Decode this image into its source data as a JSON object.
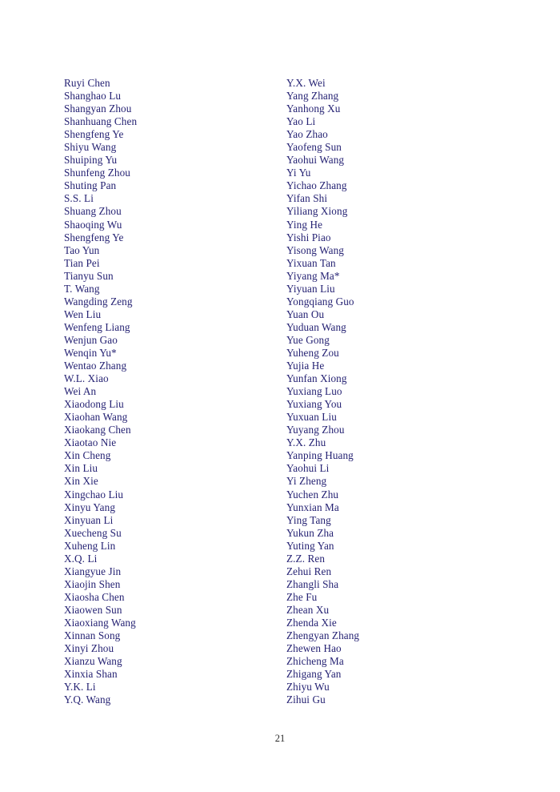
{
  "document": {
    "page_number": "21",
    "text_color": "#252273",
    "page_number_color": "#2a2a2a",
    "background_color": "#ffffff"
  },
  "columns": {
    "left": [
      "Ruyi Chen",
      "Shanghao Lu",
      "Shangyan Zhou",
      "Shanhuang Chen",
      "Shengfeng Ye",
      "Shiyu Wang",
      "Shuiping Yu",
      "Shunfeng Zhou",
      "Shuting Pan",
      "S.S. Li",
      "Shuang Zhou",
      "Shaoqing Wu",
      "Shengfeng Ye",
      "Tao Yun",
      "Tian Pei",
      "Tianyu Sun",
      "T. Wang",
      "Wangding Zeng",
      "Wen Liu",
      "Wenfeng Liang",
      "Wenjun Gao",
      "Wenqin Yu*",
      "Wentao Zhang",
      "W.L. Xiao",
      "Wei An",
      "Xiaodong Liu",
      "Xiaohan Wang",
      "Xiaokang Chen",
      "Xiaotao Nie",
      "Xin Cheng",
      "Xin Liu",
      "Xin Xie",
      "Xingchao Liu",
      "Xinyu Yang",
      "Xinyuan Li",
      "Xuecheng Su",
      "Xuheng Lin",
      "X.Q. Li",
      "Xiangyue Jin",
      "Xiaojin Shen",
      "Xiaosha Chen",
      "Xiaowen Sun",
      "Xiaoxiang Wang",
      "Xinnan Song",
      "Xinyi Zhou",
      "Xianzu Wang",
      "Xinxia Shan",
      "Y.K. Li",
      "Y.Q. Wang"
    ],
    "right": [
      "Y.X. Wei",
      "Yang Zhang",
      "Yanhong Xu",
      "Yao Li",
      "Yao Zhao",
      "Yaofeng Sun",
      "Yaohui Wang",
      "Yi Yu",
      "Yichao Zhang",
      "Yifan Shi",
      "Yiliang Xiong",
      "Ying He",
      "Yishi Piao",
      "Yisong Wang",
      "Yixuan Tan",
      "Yiyang Ma*",
      "Yiyuan Liu",
      "Yongqiang Guo",
      "Yuan Ou",
      "Yuduan Wang",
      "Yue Gong",
      "Yuheng Zou",
      "Yujia He",
      "Yunfan Xiong",
      "Yuxiang Luo",
      "Yuxiang You",
      "Yuxuan Liu",
      "Yuyang Zhou",
      "Y.X. Zhu",
      "Yanping Huang",
      "Yaohui Li",
      "Yi Zheng",
      "Yuchen Zhu",
      "Yunxian Ma",
      "Ying Tang",
      "Yukun Zha",
      "Yuting Yan",
      "Z.Z. Ren",
      "Zehui Ren",
      "Zhangli Sha",
      "Zhe Fu",
      "Zhean Xu",
      "Zhenda Xie",
      "Zhengyan Zhang",
      "Zhewen Hao",
      "Zhicheng Ma",
      "Zhigang Yan",
      "Zhiyu Wu",
      "Zihui Gu"
    ]
  }
}
